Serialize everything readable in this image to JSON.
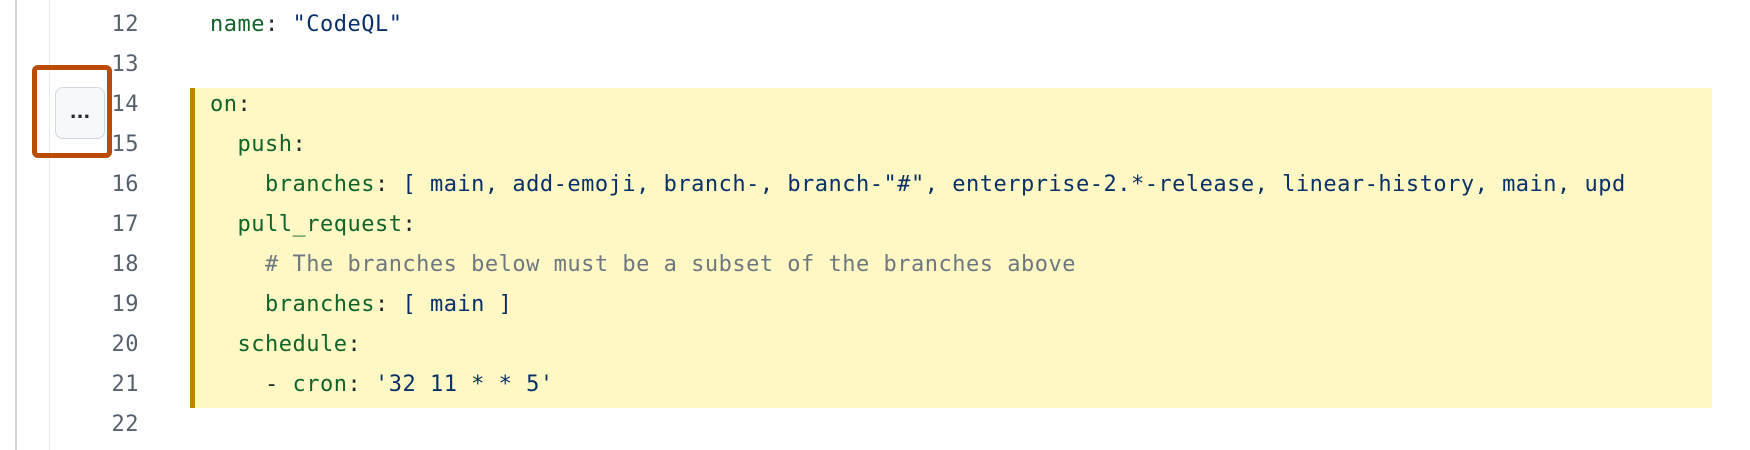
{
  "editor": {
    "line_numbers": [
      "12",
      "13",
      "14",
      "15",
      "16",
      "17",
      "18",
      "19",
      "20",
      "21",
      "22"
    ],
    "lines": {
      "line12": {
        "key": "name",
        "colon": ": ",
        "value": "\"CodeQL\""
      },
      "line14": {
        "key": "on",
        "colon": ":"
      },
      "line15": {
        "indent": "  ",
        "key": "push",
        "colon": ":"
      },
      "line16": {
        "indent": "    ",
        "key": "branches",
        "colon": ": ",
        "value": "[ main, add-emoji, branch-, branch-\"#\", enterprise-2.*-release, linear-history, main, upd"
      },
      "line17": {
        "indent": "  ",
        "key": "pull_request",
        "colon": ":"
      },
      "line18": {
        "indent": "    ",
        "comment": "# The branches below must be a subset of the branches above"
      },
      "line19": {
        "indent": "    ",
        "key": "branches",
        "colon": ": ",
        "value": "[ main ]"
      },
      "line20": {
        "indent": "  ",
        "key": "schedule",
        "colon": ":"
      },
      "line21": {
        "indent": "    ",
        "dash": "- ",
        "key": "cron",
        "colon": ": ",
        "value": "'32 11 * * 5'"
      }
    }
  },
  "more_button": {
    "icon": "kebab-horizontal-icon",
    "label": "..."
  },
  "colors": {
    "highlight_bg": "#fff8c5",
    "highlight_border": "#bf8700",
    "callout_border": "#bc4c00",
    "key": "#116329",
    "string": "#0a3069",
    "comment": "#6e7781"
  }
}
